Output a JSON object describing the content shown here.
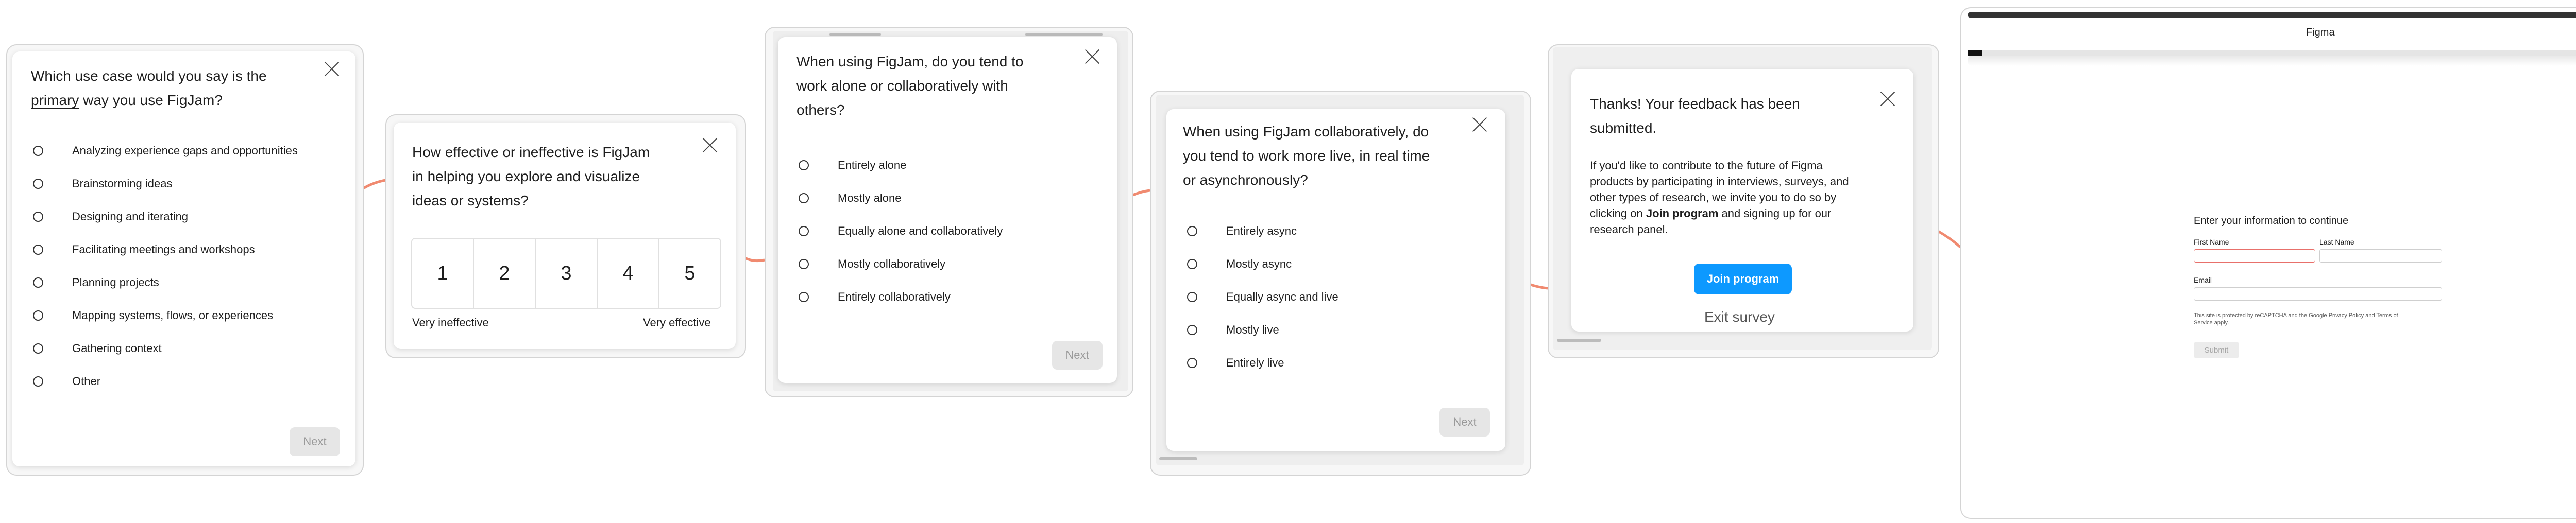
{
  "colors": {
    "connector": "#f08a70",
    "accent": "#0d99ff",
    "error": "#e8706b"
  },
  "screen1": {
    "question_pre": "Which use case would you say is the",
    "question_emph": "primary",
    "question_post": "way you use FigJam?",
    "options": [
      "Analyzing experience gaps and opportunities",
      "Brainstorming ideas",
      "Designing and iterating",
      "Facilitating meetings and workshops",
      "Planning projects",
      "Mapping systems, flows, or experiences",
      "Gathering context",
      "Other"
    ],
    "next_label": "Next"
  },
  "screen2": {
    "question_line1": "How effective or ineffective is FigJam",
    "question_line2": "in helping you explore and visualize",
    "question_line3": "ideas or systems?",
    "scale": [
      "1",
      "2",
      "3",
      "4",
      "5"
    ],
    "low_label": "Very ineffective",
    "high_label": "Very effective"
  },
  "screen3": {
    "question_line1": "When using FigJam, do you tend to",
    "question_line2": "work alone or collaboratively with",
    "question_line3": "others?",
    "options": [
      "Entirely alone",
      "Mostly alone",
      "Equally alone and collaboratively",
      "Mostly collaboratively",
      "Entirely collaboratively"
    ],
    "next_label": "Next"
  },
  "screen4": {
    "question_line1": "When using FigJam collaboratively, do",
    "question_line2": "you tend to work more live, in real time",
    "question_line3": "or asynchronously?",
    "options": [
      "Entirely async",
      "Mostly async",
      "Equally async and live",
      "Mostly live",
      "Entirely live"
    ],
    "next_label": "Next"
  },
  "screen5": {
    "title_line1": "Thanks! Your feedback has been",
    "title_line2": "submitted.",
    "body_line1": "If you'd like to contribute to the future of Figma",
    "body_line2": "products by participating in interviews, surveys, and",
    "body_line3": "other types of research, we invite you to do so by",
    "body_line4_pre": "clicking on",
    "body_line4_bold": "Join program",
    "body_line4_post": "and signing up for our",
    "body_line5": "research panel.",
    "join_label": "Join program",
    "exit_label": "Exit survey"
  },
  "screen6": {
    "window_title": "Figma",
    "progress": 0.02,
    "form_title": "Enter your information to continue",
    "first_name_label": "First Name",
    "last_name_label": "Last Name",
    "email_label": "Email",
    "legal_pre": "This site is protected by reCAPTCHA and the Google",
    "privacy_label": "Privacy Policy",
    "legal_and": "and",
    "terms_label": "Terms of",
    "terms_label2": "Service",
    "legal_post": "apply.",
    "submit_label": "Submit"
  }
}
